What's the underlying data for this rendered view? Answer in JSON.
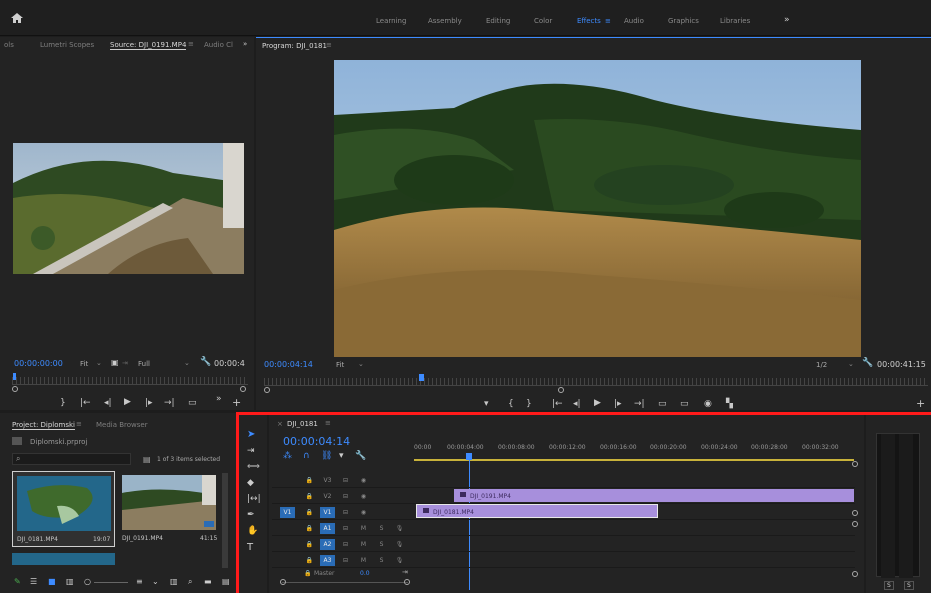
{
  "workspaces": [
    "Learning",
    "Assembly",
    "Editing",
    "Color",
    "Effects",
    "Audio",
    "Graphics",
    "Libraries"
  ],
  "active_workspace": "Effects",
  "source_panel": {
    "tabs": [
      "ols",
      "Lumetri Scopes",
      "Source: DJI_0191.MP4",
      "Audio Cl"
    ],
    "timecode": "00:00:00:00",
    "fit": "Fit",
    "resolution": "Full",
    "duration": "00:00:4"
  },
  "program_panel": {
    "title": "Program: DJI_0181",
    "timecode": "00:00:04:14",
    "fit": "Fit",
    "resolution": "1/2",
    "duration": "00:00:41:15"
  },
  "project_panel": {
    "tabs": [
      "Project: Diplomski",
      "Media Browser"
    ],
    "file": "Diplomski.prproj",
    "selection": "1 of 3 items selected",
    "items": [
      {
        "name": "DJI_0181.MP4",
        "duration": "19:07"
      },
      {
        "name": "DJI_0191.MP4",
        "duration": "41:15"
      }
    ]
  },
  "timeline": {
    "sequence": "DJI_0181",
    "timecode": "00:00:04:14",
    "ruler": [
      "00:00",
      "00:00:04:00",
      "00:00:08:00",
      "00:00:12:00",
      "00:00:16:00",
      "00:00:20:00",
      "00:00:24:00",
      "00:00:28:00",
      "00:00:32:00"
    ],
    "video_tracks": [
      "V3",
      "V2",
      "V1"
    ],
    "audio_tracks": [
      "A1",
      "A2",
      "A3"
    ],
    "master_label": "Master",
    "master_value": "0.0",
    "clips": [
      {
        "name": "DJI_0191.MP4",
        "track": "V2"
      },
      {
        "name": "DJI_0181.MP4",
        "track": "V1"
      }
    ]
  },
  "meter_labels": [
    "S",
    "S"
  ],
  "colors": {
    "accent": "#3d8bff",
    "clip": "#a78fdc",
    "highlight": "#ff1a1a"
  }
}
